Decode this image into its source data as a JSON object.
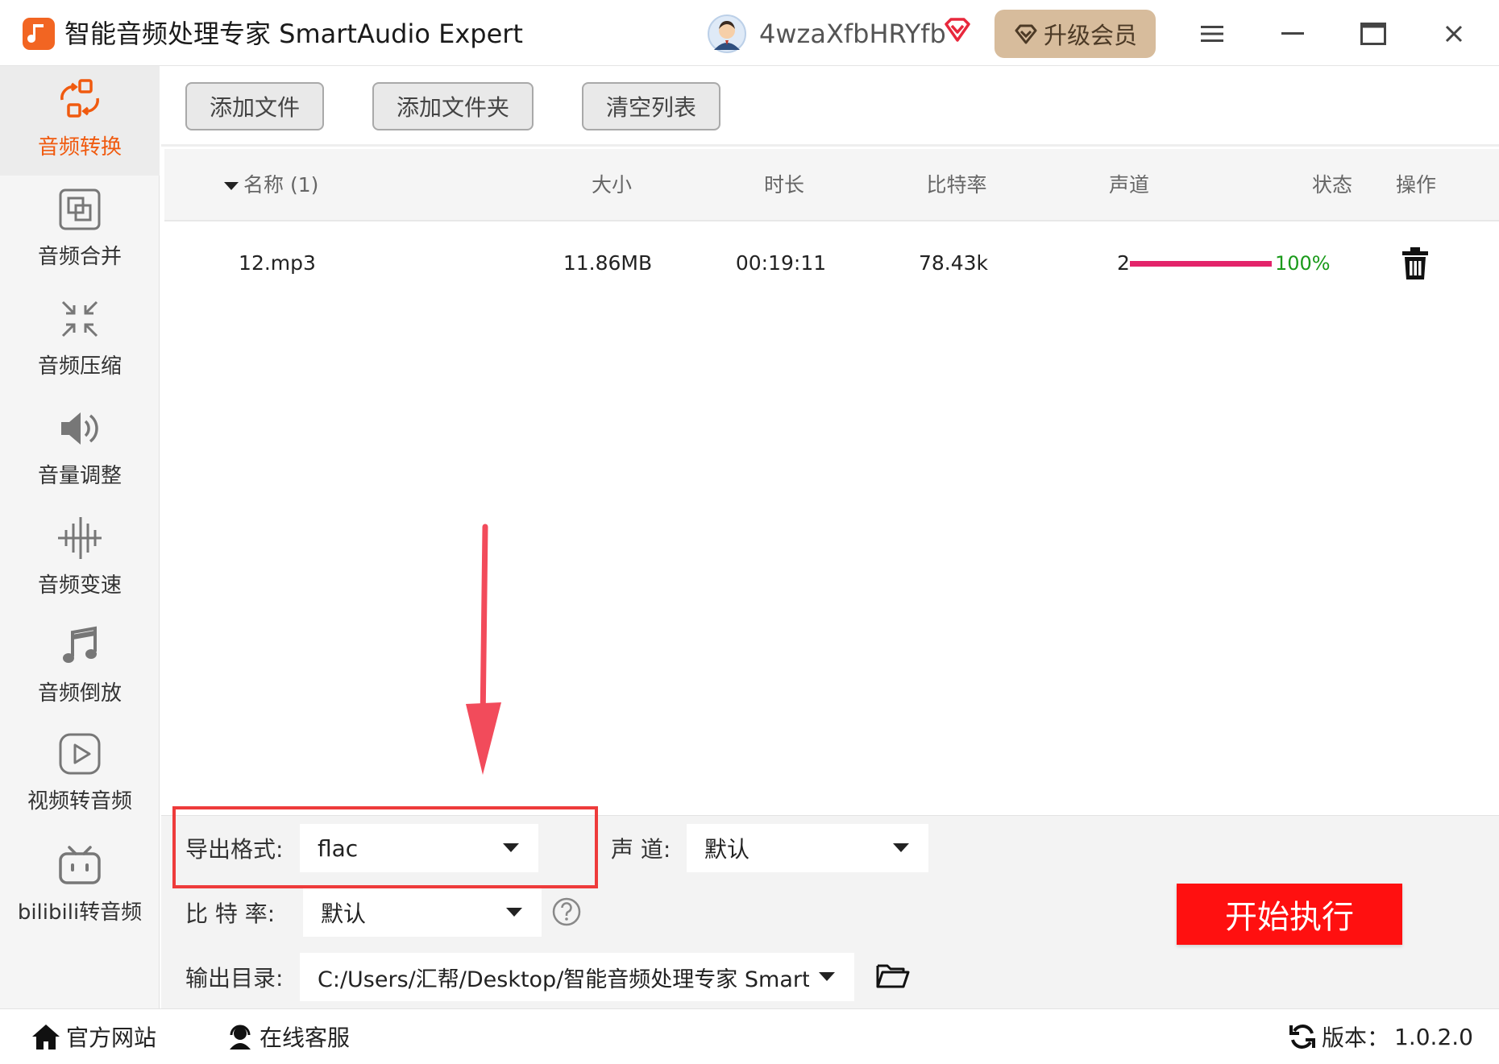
{
  "app": {
    "title": "智能音频处理专家 SmartAudio Expert",
    "username": "4wzaXfbHRYfb",
    "upgrade_label": "升级会员"
  },
  "sidebar": {
    "items": [
      {
        "label": "音频转换",
        "icon": "refresh-convert-icon",
        "active": true
      },
      {
        "label": "音频合并",
        "icon": "merge-icon"
      },
      {
        "label": "音频压缩",
        "icon": "compress-icon"
      },
      {
        "label": "音量调整",
        "icon": "volume-icon"
      },
      {
        "label": "音频变速",
        "icon": "speed-icon"
      },
      {
        "label": "音频倒放",
        "icon": "music-note-icon"
      },
      {
        "label": "视频转音频",
        "icon": "play-icon"
      },
      {
        "label": "bilibili转音频",
        "icon": "bilibili-icon"
      }
    ]
  },
  "toolbar": {
    "add_file": "添加文件",
    "add_folder": "添加文件夹",
    "clear_list": "清空列表"
  },
  "table": {
    "columns": [
      "名称 (1)",
      "大小",
      "时长",
      "比特率",
      "声道",
      "状态",
      "操作"
    ],
    "rows": [
      {
        "name": "12.mp3",
        "size": "11.86MB",
        "duration": "00:19:11",
        "bitrate": "78.43k",
        "channels": "2",
        "progress": 1.0,
        "progress_text": "100%"
      }
    ]
  },
  "settings": {
    "format_label": "导出格式:",
    "format_value": "flac",
    "channel_label": "声 道:",
    "channel_value": "默认",
    "bitrate_label": "比 特 率:",
    "bitrate_value": "默认",
    "output_label": "输出目录:",
    "output_value": "C:/Users/汇帮/Desktop/智能音频处理专家 SmartAudio Exp",
    "start_label": "开始执行"
  },
  "footer": {
    "website": "官方网站",
    "support": "在线客服",
    "version_label": "版本：",
    "version": "1.0.2.0"
  },
  "colors": {
    "accent": "#f05a0f",
    "start_button": "#ff1010",
    "highlight_box": "#ee3b3b",
    "progress": "#e3246a",
    "progress_text": "#1a9a1a",
    "upgrade_bg": "#d7bc9c"
  }
}
